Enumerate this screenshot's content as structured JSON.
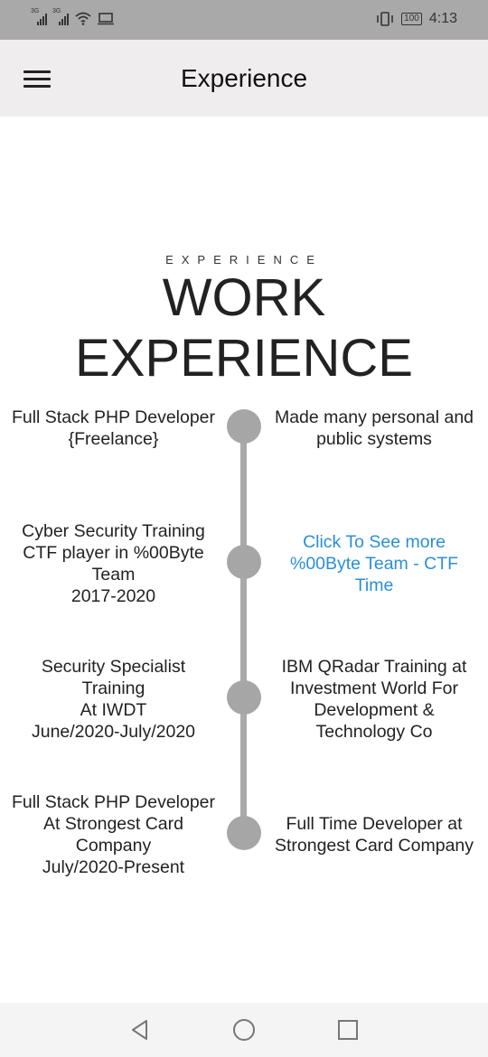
{
  "status_bar": {
    "signal1_label": "3G",
    "signal2_label": "3G",
    "battery": "100",
    "time": "4:13",
    "icons": [
      "signal-icon",
      "signal-icon",
      "wifi-icon",
      "screen-icon",
      "vibrate-icon",
      "battery-icon"
    ]
  },
  "app_bar": {
    "title": "Experience",
    "menu_icon": "hamburger-menu-icon"
  },
  "section": {
    "eyebrow": "EXPERIENCE",
    "headline": "WORK EXPERIENCE"
  },
  "timeline": [
    {
      "left": "Full Stack PHP Developer\n{Freelance}",
      "right": "Made many personal and\npublic systems",
      "right_is_link": false
    },
    {
      "left": "Cyber Security Training\nCTF player in %00Byte\nTeam\n2017-2020",
      "right": "Click To See more\n%00Byte Team - CTF\nTime",
      "right_is_link": true
    },
    {
      "left": "Security Specialist\nTraining\nAt IWDT\nJune/2020-July/2020",
      "right": "IBM QRadar Training at\nInvestment World For\nDevelopment &\nTechnology Co",
      "right_is_link": false
    },
    {
      "left": "Full Stack PHP Developer\nAt Strongest Card\nCompany\nJuly/2020-Present",
      "right": "Full Time Developer at\nStrongest Card Company",
      "right_is_link": false
    }
  ],
  "nav_bar": {
    "icons": [
      "back-icon",
      "home-icon",
      "recents-icon"
    ]
  },
  "colors": {
    "status_bar_bg": "#a9a9a9",
    "app_bar_bg": "#efeded",
    "timeline_gray": "#a6a6a6",
    "link_blue": "#2a8fd6"
  }
}
